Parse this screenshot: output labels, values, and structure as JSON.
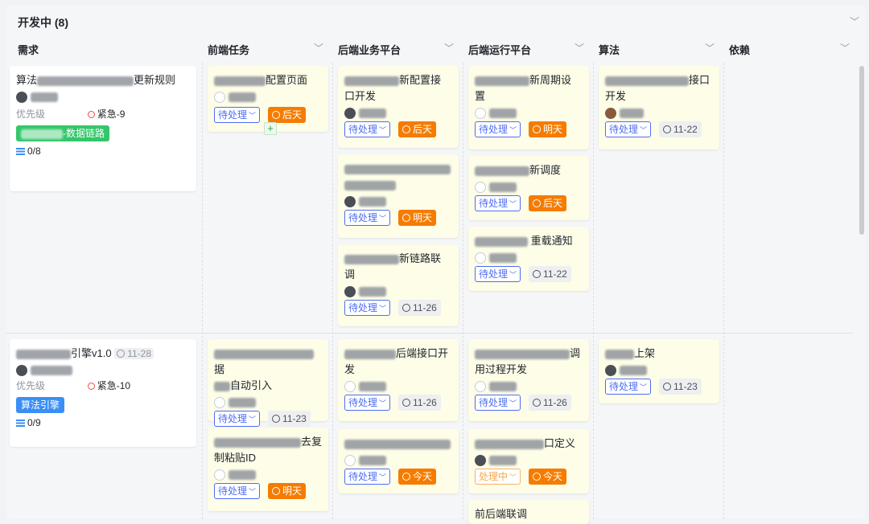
{
  "group": {
    "title": "开发中 (8)"
  },
  "columns": [
    "需求",
    "前端任务",
    "后端业务平台",
    "后端运行平台",
    "算法",
    "依赖"
  ],
  "rows": [
    {
      "requirement": {
        "title_prefix": "算法",
        "title_suffix": "更新规则",
        "priority_label": "优先级",
        "urgency": "紧急-9",
        "tag_suffix": "-数据链路",
        "progress": "0/8"
      },
      "tasks": {
        "frontend": [
          {
            "text": "配置页面",
            "status": "待处理",
            "due": "后天",
            "due_style": "orange"
          }
        ],
        "backend_biz": [
          {
            "text_l1": "新配置接",
            "text_l2": "口开发",
            "status": "待处理",
            "due": "后天",
            "due_style": "orange"
          },
          {
            "text_l1": "",
            "text_l2": "",
            "status": "待处理",
            "due": "明天",
            "due_style": "orange"
          },
          {
            "text_l1": "新链路联",
            "text_l2": "调",
            "status": "待处理",
            "due": "11-26",
            "due_style": "gray"
          }
        ],
        "backend_run": [
          {
            "text_l1": "新周期设",
            "text_l2": "置",
            "status": "待处理",
            "due": "明天",
            "due_style": "orange"
          },
          {
            "text_l1": "新调度",
            "text_l2": "",
            "status": "待处理",
            "due": "后天",
            "due_style": "orange"
          },
          {
            "text_l1": "重载通知",
            "text_l2": "",
            "status": "待处理",
            "due": "11-22",
            "due_style": "gray"
          }
        ],
        "algo": [
          {
            "text_l1": "接口",
            "text_l2": "开发",
            "status": "待处理",
            "due": "11-22",
            "due_style": "gray"
          }
        ]
      }
    },
    {
      "requirement": {
        "title_suffix": "引擎v1.0",
        "date": "11-28",
        "priority_label": "优先级",
        "urgency": "紧急-10",
        "tag": "算法引擎",
        "progress": "0/9"
      },
      "tasks": {
        "frontend": [
          {
            "text_l1": "据",
            "text_l2": "自动引入",
            "status": "待处理",
            "due": "11-23",
            "due_style": "gray"
          },
          {
            "text_l1": "去复",
            "text_l2": "制粘贴ID",
            "status": "待处理",
            "due": "明天",
            "due_style": "orange"
          }
        ],
        "backend_biz": [
          {
            "text_l1": "后端接口开",
            "text_l2": "发",
            "status": "待处理",
            "due": "11-26",
            "due_style": "gray"
          },
          {
            "text_l1": "",
            "text_l2": "",
            "status": "待处理",
            "due": "今天",
            "due_style": "orange"
          }
        ],
        "backend_run": [
          {
            "text_l1": "调",
            "text_l2": "用过程开发",
            "status": "待处理",
            "due": "11-26",
            "due_style": "gray"
          },
          {
            "text_l1": "口定义",
            "text_l2": "",
            "status": "处理中",
            "due": "今天",
            "due_style": "orange"
          },
          {
            "text_l1": "前后端联调",
            "text_l2": ""
          }
        ],
        "algo": [
          {
            "text_l1": "上架",
            "text_l2": "",
            "status": "待处理",
            "due": "11-23",
            "due_style": "gray"
          }
        ]
      }
    }
  ],
  "colors": {
    "accent": "#4e6ef2",
    "due_orange": "#f57c00",
    "tag_green": "#34c76a",
    "tag_blue": "#3a8ef6",
    "urgent_red": "#f54a45"
  },
  "icons": [
    "chevron-down-icon",
    "clock-icon",
    "list-icon",
    "plus-icon"
  ]
}
